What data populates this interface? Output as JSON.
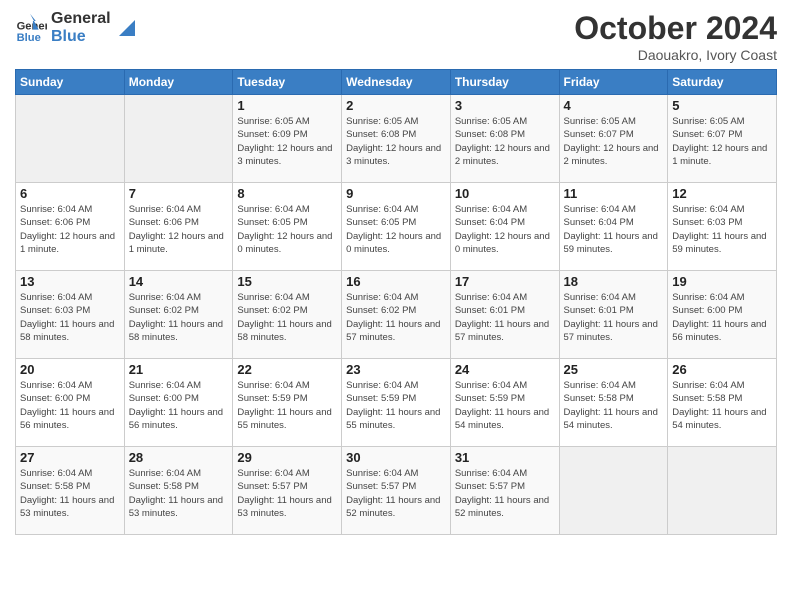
{
  "header": {
    "logo_general": "General",
    "logo_blue": "Blue",
    "title": "October 2024",
    "subtitle": "Daouakro, Ivory Coast"
  },
  "weekdays": [
    "Sunday",
    "Monday",
    "Tuesday",
    "Wednesday",
    "Thursday",
    "Friday",
    "Saturday"
  ],
  "weeks": [
    [
      {
        "day": "",
        "info": ""
      },
      {
        "day": "",
        "info": ""
      },
      {
        "day": "1",
        "info": "Sunrise: 6:05 AM\nSunset: 6:09 PM\nDaylight: 12 hours and 3 minutes."
      },
      {
        "day": "2",
        "info": "Sunrise: 6:05 AM\nSunset: 6:08 PM\nDaylight: 12 hours and 3 minutes."
      },
      {
        "day": "3",
        "info": "Sunrise: 6:05 AM\nSunset: 6:08 PM\nDaylight: 12 hours and 2 minutes."
      },
      {
        "day": "4",
        "info": "Sunrise: 6:05 AM\nSunset: 6:07 PM\nDaylight: 12 hours and 2 minutes."
      },
      {
        "day": "5",
        "info": "Sunrise: 6:05 AM\nSunset: 6:07 PM\nDaylight: 12 hours and 1 minute."
      }
    ],
    [
      {
        "day": "6",
        "info": "Sunrise: 6:04 AM\nSunset: 6:06 PM\nDaylight: 12 hours and 1 minute."
      },
      {
        "day": "7",
        "info": "Sunrise: 6:04 AM\nSunset: 6:06 PM\nDaylight: 12 hours and 1 minute."
      },
      {
        "day": "8",
        "info": "Sunrise: 6:04 AM\nSunset: 6:05 PM\nDaylight: 12 hours and 0 minutes."
      },
      {
        "day": "9",
        "info": "Sunrise: 6:04 AM\nSunset: 6:05 PM\nDaylight: 12 hours and 0 minutes."
      },
      {
        "day": "10",
        "info": "Sunrise: 6:04 AM\nSunset: 6:04 PM\nDaylight: 12 hours and 0 minutes."
      },
      {
        "day": "11",
        "info": "Sunrise: 6:04 AM\nSunset: 6:04 PM\nDaylight: 11 hours and 59 minutes."
      },
      {
        "day": "12",
        "info": "Sunrise: 6:04 AM\nSunset: 6:03 PM\nDaylight: 11 hours and 59 minutes."
      }
    ],
    [
      {
        "day": "13",
        "info": "Sunrise: 6:04 AM\nSunset: 6:03 PM\nDaylight: 11 hours and 58 minutes."
      },
      {
        "day": "14",
        "info": "Sunrise: 6:04 AM\nSunset: 6:02 PM\nDaylight: 11 hours and 58 minutes."
      },
      {
        "day": "15",
        "info": "Sunrise: 6:04 AM\nSunset: 6:02 PM\nDaylight: 11 hours and 58 minutes."
      },
      {
        "day": "16",
        "info": "Sunrise: 6:04 AM\nSunset: 6:02 PM\nDaylight: 11 hours and 57 minutes."
      },
      {
        "day": "17",
        "info": "Sunrise: 6:04 AM\nSunset: 6:01 PM\nDaylight: 11 hours and 57 minutes."
      },
      {
        "day": "18",
        "info": "Sunrise: 6:04 AM\nSunset: 6:01 PM\nDaylight: 11 hours and 57 minutes."
      },
      {
        "day": "19",
        "info": "Sunrise: 6:04 AM\nSunset: 6:00 PM\nDaylight: 11 hours and 56 minutes."
      }
    ],
    [
      {
        "day": "20",
        "info": "Sunrise: 6:04 AM\nSunset: 6:00 PM\nDaylight: 11 hours and 56 minutes."
      },
      {
        "day": "21",
        "info": "Sunrise: 6:04 AM\nSunset: 6:00 PM\nDaylight: 11 hours and 56 minutes."
      },
      {
        "day": "22",
        "info": "Sunrise: 6:04 AM\nSunset: 5:59 PM\nDaylight: 11 hours and 55 minutes."
      },
      {
        "day": "23",
        "info": "Sunrise: 6:04 AM\nSunset: 5:59 PM\nDaylight: 11 hours and 55 minutes."
      },
      {
        "day": "24",
        "info": "Sunrise: 6:04 AM\nSunset: 5:59 PM\nDaylight: 11 hours and 54 minutes."
      },
      {
        "day": "25",
        "info": "Sunrise: 6:04 AM\nSunset: 5:58 PM\nDaylight: 11 hours and 54 minutes."
      },
      {
        "day": "26",
        "info": "Sunrise: 6:04 AM\nSunset: 5:58 PM\nDaylight: 11 hours and 54 minutes."
      }
    ],
    [
      {
        "day": "27",
        "info": "Sunrise: 6:04 AM\nSunset: 5:58 PM\nDaylight: 11 hours and 53 minutes."
      },
      {
        "day": "28",
        "info": "Sunrise: 6:04 AM\nSunset: 5:58 PM\nDaylight: 11 hours and 53 minutes."
      },
      {
        "day": "29",
        "info": "Sunrise: 6:04 AM\nSunset: 5:57 PM\nDaylight: 11 hours and 53 minutes."
      },
      {
        "day": "30",
        "info": "Sunrise: 6:04 AM\nSunset: 5:57 PM\nDaylight: 11 hours and 52 minutes."
      },
      {
        "day": "31",
        "info": "Sunrise: 6:04 AM\nSunset: 5:57 PM\nDaylight: 11 hours and 52 minutes."
      },
      {
        "day": "",
        "info": ""
      },
      {
        "day": "",
        "info": ""
      }
    ]
  ]
}
